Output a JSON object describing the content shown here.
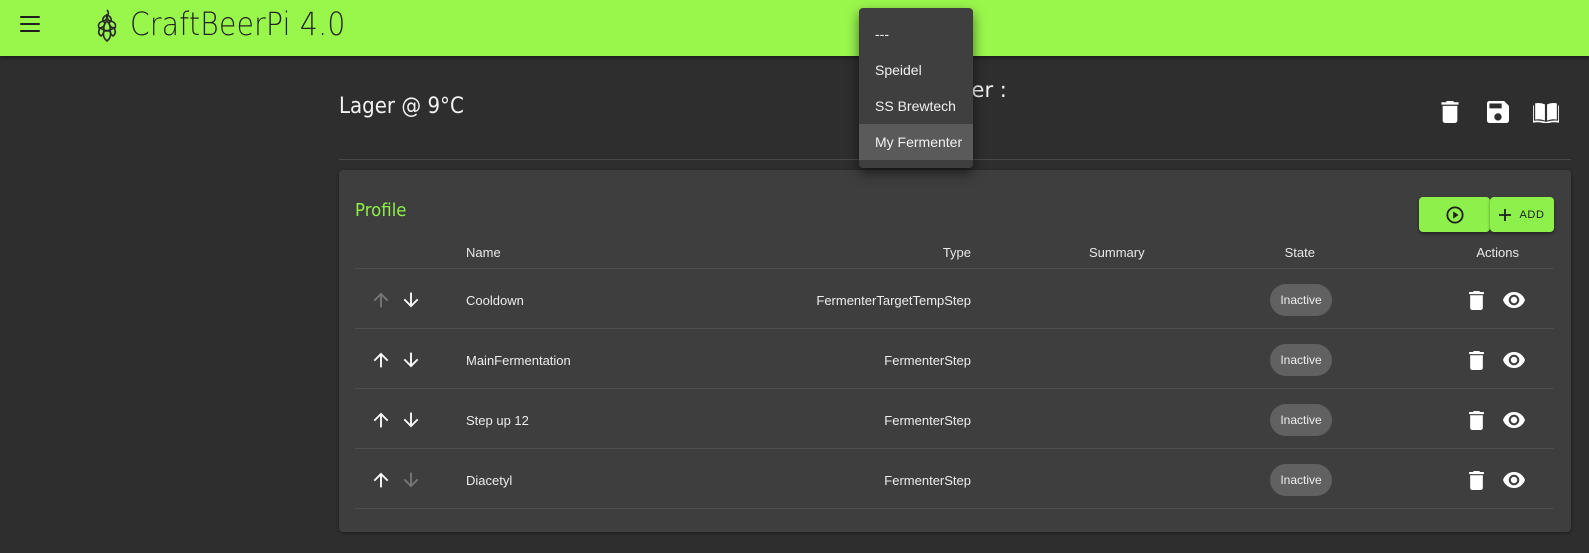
{
  "app": {
    "brand": "CraftBeerPi 4.0"
  },
  "header": {
    "title": "Lager @ 9°C",
    "fermenter_label": "nter :"
  },
  "fermenter_dropdown": {
    "options": [
      "---",
      "Speidel",
      "SS Brewtech",
      "My Fermenter"
    ],
    "selected": "My Fermenter"
  },
  "profile": {
    "title": "Profile",
    "add_label": "ADD",
    "columns": {
      "name": "Name",
      "type": "Type",
      "summary": "Summary",
      "state": "State",
      "actions": "Actions"
    },
    "steps": [
      {
        "name": "Cooldown",
        "type": "FermenterTargetTempStep",
        "summary": "",
        "state": "Inactive",
        "up_enabled": false,
        "down_enabled": true
      },
      {
        "name": "MainFermentation",
        "type": "FermenterStep",
        "summary": "",
        "state": "Inactive",
        "up_enabled": true,
        "down_enabled": true
      },
      {
        "name": "Step up 12",
        "type": "FermenterStep",
        "summary": "",
        "state": "Inactive",
        "up_enabled": true,
        "down_enabled": true
      },
      {
        "name": "Diacetyl",
        "type": "FermenterStep",
        "summary": "",
        "state": "Inactive",
        "up_enabled": true,
        "down_enabled": false
      }
    ]
  },
  "colors": {
    "accent": "#99f74c",
    "background": "#2e2e2e",
    "panel": "#3e3e3e",
    "badge": "#616161"
  },
  "icons": [
    "menu-icon",
    "hop-logo-icon",
    "delete-icon",
    "save-icon",
    "book-icon",
    "play-circle-icon",
    "plus-icon",
    "arrow-up-icon",
    "arrow-down-icon",
    "eye-icon"
  ]
}
